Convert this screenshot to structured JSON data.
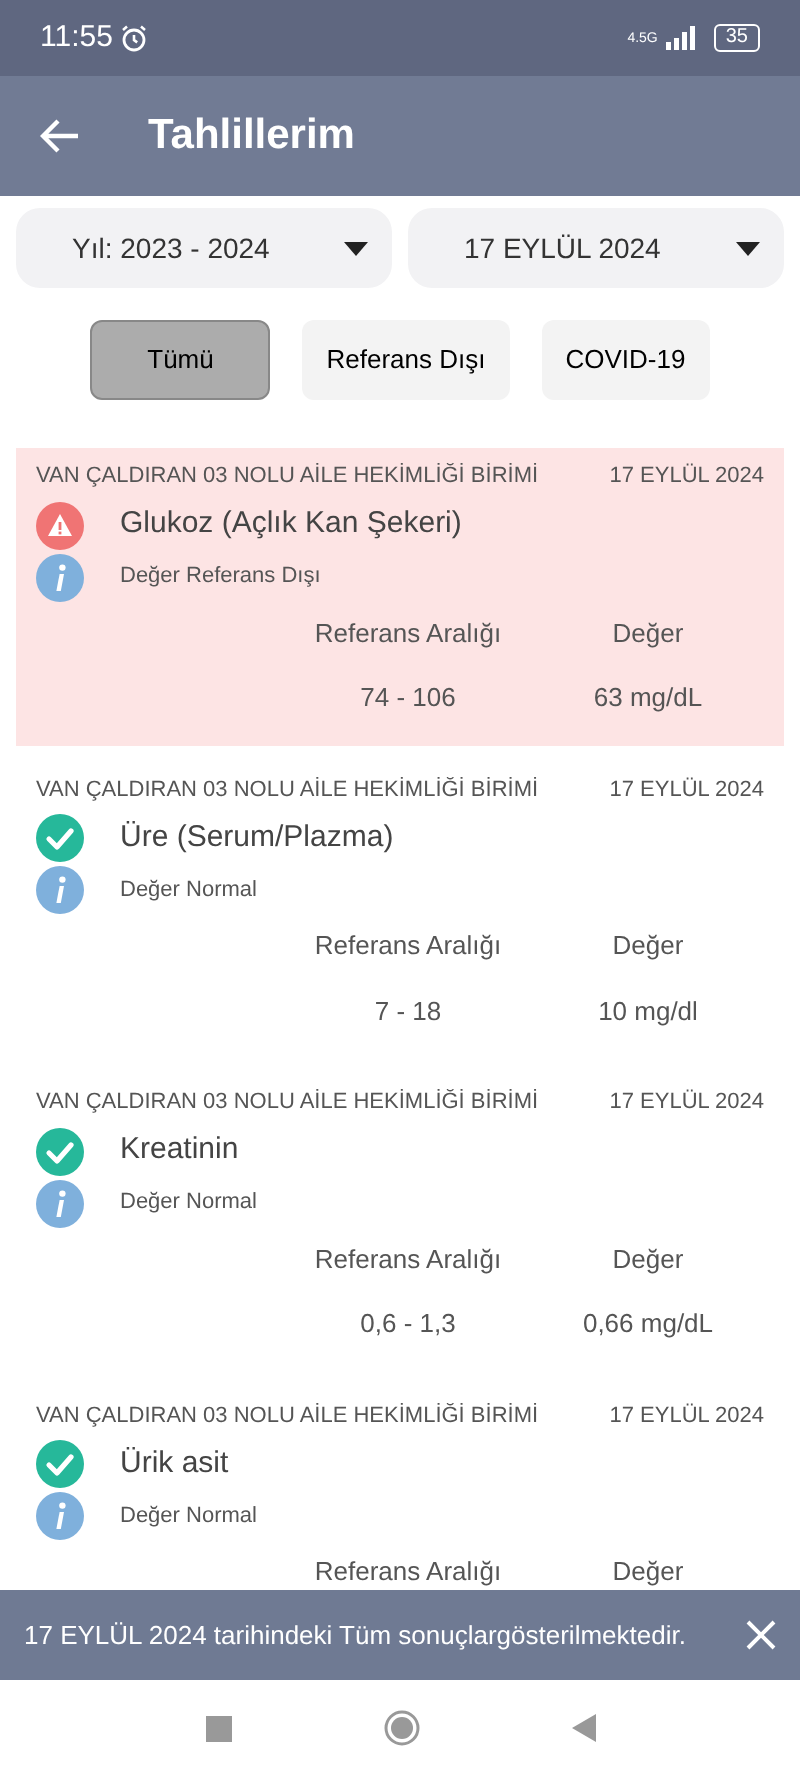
{
  "status_bar": {
    "time": "11:55",
    "network": "4.5G",
    "battery": "35"
  },
  "header": {
    "title": "Tahlillerim"
  },
  "dropdowns": [
    {
      "value": "Yıl: 2023 - 2024"
    },
    {
      "value": "17 EYLÜL 2024"
    }
  ],
  "filters": [
    {
      "label": "Tümü",
      "selected": true
    },
    {
      "label": "Referans Dışı",
      "selected": false
    },
    {
      "label": "COVID-19",
      "selected": false
    }
  ],
  "results": [
    {
      "kind": "abnormal",
      "institution": "VAN ÇALDIRAN 03 NOLU AİLE HEKİMLİĞİ BİRİMİ",
      "date": "17 EYLÜL 2024",
      "test": "Glukoz (Açlık Kan Şekeri)",
      "status": "Değer Referans Dışı",
      "range_label": "Referans Aralığı",
      "value_label": "Değer",
      "range": "74 - 106",
      "value": "63 mg/dL"
    },
    {
      "kind": "normal",
      "institution": "VAN ÇALDIRAN 03 NOLU AİLE HEKİMLİĞİ BİRİMİ",
      "date": "17 EYLÜL 2024",
      "test": "Üre (Serum/Plazma)",
      "status": "Değer Normal",
      "range_label": "Referans Aralığı",
      "value_label": "Değer",
      "range": "7 - 18",
      "value": "10 mg/dl"
    },
    {
      "kind": "normal",
      "institution": "VAN ÇALDIRAN 03 NOLU AİLE HEKİMLİĞİ BİRİMİ",
      "date": "17 EYLÜL 2024",
      "test": "Kreatinin",
      "status": "Değer Normal",
      "range_label": "Referans Aralığı",
      "value_label": "Değer",
      "range": "0,6 - 1,3",
      "value": "0,66 mg/dL"
    },
    {
      "kind": "normal",
      "institution": "VAN ÇALDIRAN 03 NOLU AİLE HEKİMLİĞİ BİRİMİ",
      "date": "17 EYLÜL 2024",
      "test": "Ürik asit",
      "status": "Değer Normal",
      "range_label": "Referans Aralığı",
      "value_label": "Değer"
    }
  ],
  "snackbar": {
    "message": "17 EYLÜL 2024 tarihindeki Tüm sonuçlargösterilmektedir."
  }
}
